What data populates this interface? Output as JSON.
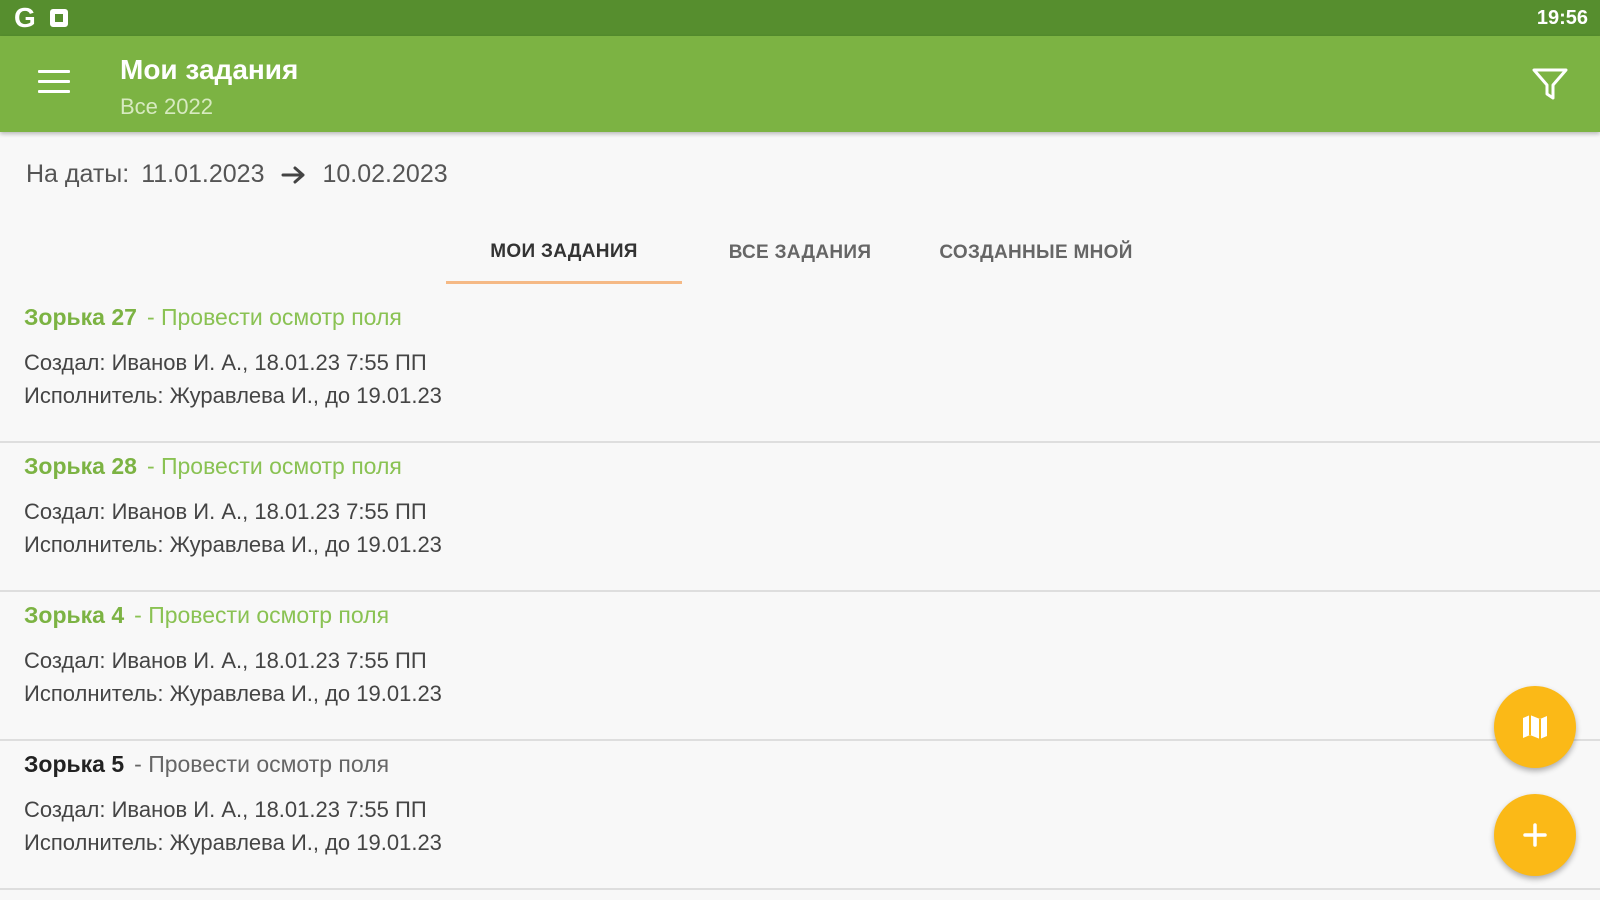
{
  "status_bar": {
    "time": "19:56",
    "icons": [
      "google-icon",
      "notification-icon"
    ]
  },
  "app_bar": {
    "title": "Мои задания",
    "subtitle": "Все 2022",
    "icons": [
      "menu-icon",
      "filter-icon"
    ]
  },
  "date_range": {
    "label": "На даты:",
    "from": "11.01.2023",
    "to": "10.02.2023"
  },
  "tabs": [
    {
      "label": "МОИ ЗАДАНИЯ",
      "active": true
    },
    {
      "label": "ВСЕ ЗАДАНИЯ",
      "active": false
    },
    {
      "label": "СОЗДАННЫЕ МНОЙ",
      "active": false
    }
  ],
  "tasks": [
    {
      "name": "Зорька 27",
      "desc": "- Провести осмотр поля",
      "created": "Создал: Иванов И. А., 18.01.23 7:55 ПП",
      "executor": "Исполнитель: Журавлева  И., до 19.01.23"
    },
    {
      "name": "Зорька 28",
      "desc": "- Провести осмотр поля",
      "created": "Создал: Иванов И. А., 18.01.23 7:55 ПП",
      "executor": "Исполнитель: Журавлева  И., до 19.01.23"
    },
    {
      "name": "Зорька 4",
      "desc": "- Провести осмотр поля",
      "created": "Создал: Иванов И. А., 18.01.23 7:55 ПП",
      "executor": "Исполнитель: Журавлева  И., до 19.01.23"
    },
    {
      "name": "Зорька 5",
      "desc": "- Провести осмотр поля",
      "created": "Создал: Иванов И. А., 18.01.23 7:55 ПП",
      "executor": "Исполнитель: Журавлева  И., до 19.01.23"
    }
  ],
  "fabs": {
    "map_icon": "map-icon",
    "add_icon": "plus-icon"
  },
  "colors": {
    "status_bar": "#568e2e",
    "app_bar": "#7cb343",
    "accent_tab": "#f5b985",
    "fab": "#fbb917",
    "task_title": "#7cb343"
  }
}
